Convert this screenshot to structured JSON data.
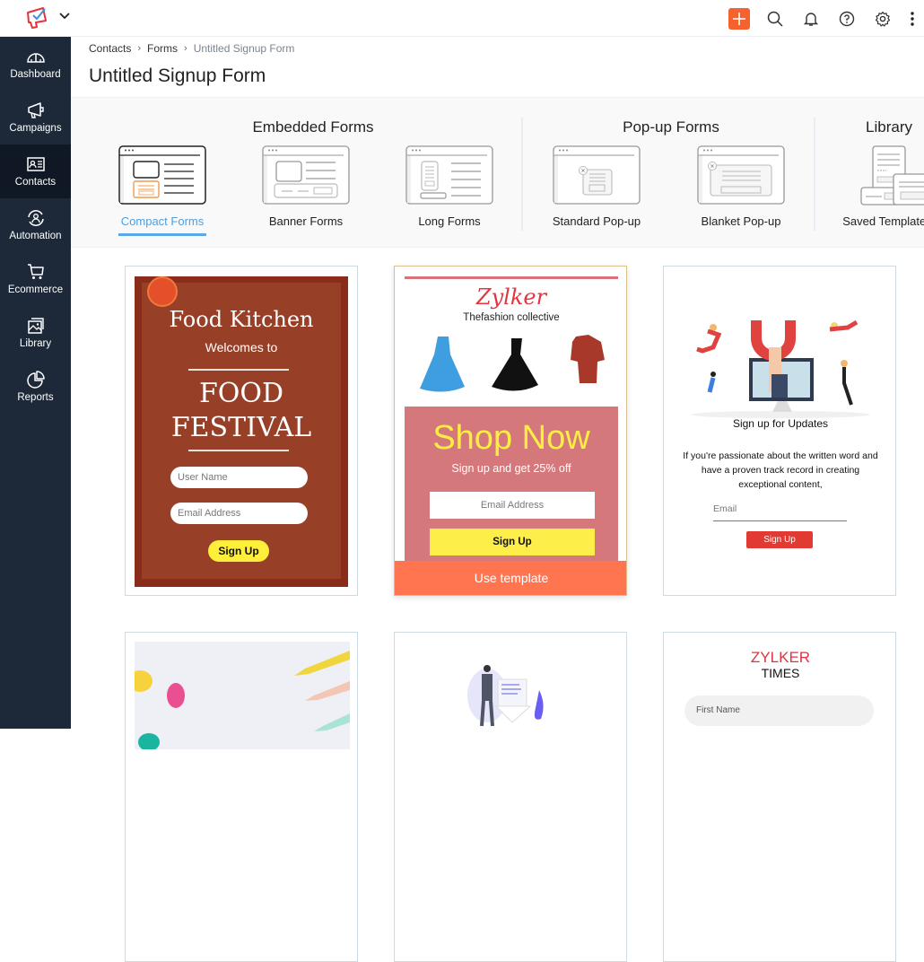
{
  "topbar": {
    "logo_icon": "megaphone-logo-icon",
    "app_switcher_icon": "chevron-down-icon",
    "actions": [
      {
        "name": "create-button",
        "icon": "plus-icon",
        "color": "#f5622e"
      },
      {
        "name": "search-button",
        "icon": "search-icon"
      },
      {
        "name": "notifications-button",
        "icon": "bell-icon"
      },
      {
        "name": "help-button",
        "icon": "help-icon"
      },
      {
        "name": "settings-button",
        "icon": "gear-icon"
      },
      {
        "name": "more-button",
        "icon": "more-vertical-icon"
      }
    ]
  },
  "sidebar": {
    "items": [
      {
        "label": "Dashboard",
        "icon": "gauge-icon",
        "active": false
      },
      {
        "label": "Campaigns",
        "icon": "megaphone-icon",
        "active": false
      },
      {
        "label": "Contacts",
        "icon": "contact-card-icon",
        "active": true
      },
      {
        "label": "Automation",
        "icon": "automation-icon",
        "active": false
      },
      {
        "label": "Ecommerce",
        "icon": "cart-icon",
        "active": false
      },
      {
        "label": "Library",
        "icon": "image-library-icon",
        "active": false
      },
      {
        "label": "Reports",
        "icon": "pie-chart-icon",
        "active": false
      }
    ]
  },
  "breadcrumb": [
    "Contacts",
    "Forms",
    "Untitled Signup Form"
  ],
  "page_title": "Untitled Signup Form",
  "form_types": {
    "groups": [
      {
        "title": "Embedded Forms"
      },
      {
        "title": "Pop-up Forms"
      },
      {
        "title": "Library"
      }
    ],
    "items": [
      {
        "label": "Compact Forms",
        "group": "Embedded Forms",
        "active": true
      },
      {
        "label": "Banner Forms",
        "group": "Embedded Forms",
        "active": false
      },
      {
        "label": "Long Forms",
        "group": "Embedded Forms",
        "active": false
      },
      {
        "label": "Standard Pop-up",
        "group": "Pop-up Forms",
        "active": false
      },
      {
        "label": "Blanket Pop-up",
        "group": "Pop-up Forms",
        "active": false
      },
      {
        "label": "Saved Templates",
        "group": "Library",
        "active": false
      }
    ]
  },
  "templates": {
    "food": {
      "title": "Food Kitchen",
      "welcome": "Welcomes to",
      "headline1": "FOOD",
      "headline2": "FESTIVAL",
      "field1": "User Name",
      "field2": "Email Address",
      "button": "Sign Up"
    },
    "fashion": {
      "brand": "Zylker",
      "tagline": "Thefashion collective",
      "headline": "Shop Now",
      "subhead": "Sign up and get 25% off",
      "field": "Email Address",
      "button": "Sign Up",
      "use_template": "Use template"
    },
    "updates": {
      "title": "Sign up for Updates",
      "description": "If you're passionate about the written word and have a proven track record in creating exceptional content,",
      "field": "Email",
      "button": "Sign Up"
    },
    "times": {
      "brand": "ZYLKER",
      "sub": "TIMES",
      "field": "First Name"
    }
  }
}
